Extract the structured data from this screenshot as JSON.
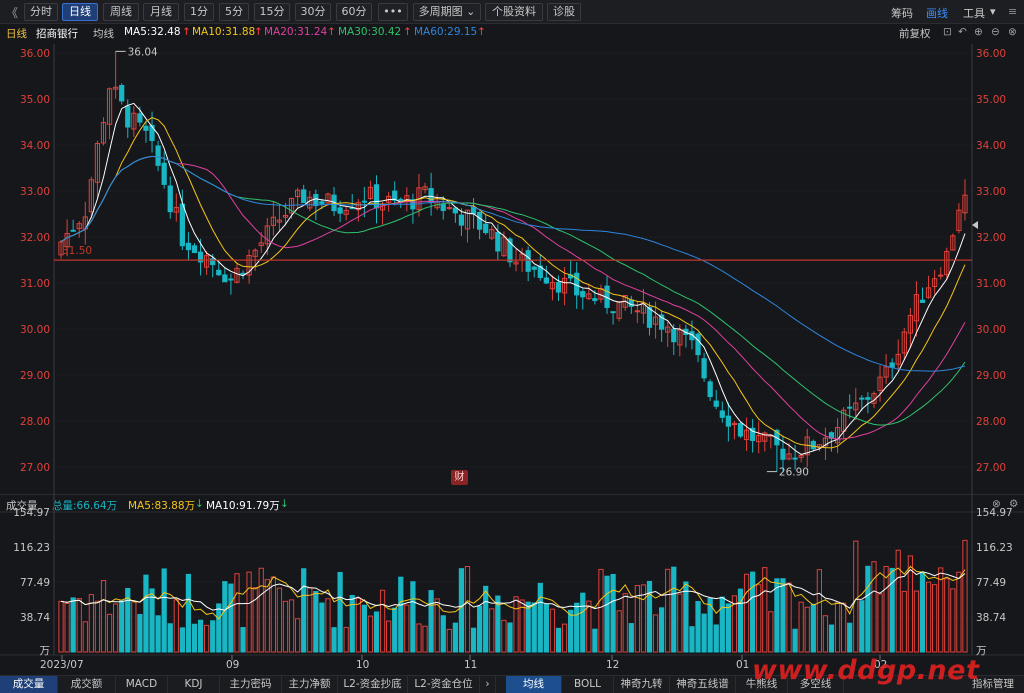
{
  "toolbar": {
    "back": "《",
    "periods": [
      "分时",
      "日线",
      "周线",
      "月线",
      "1分",
      "5分",
      "15分",
      "30分",
      "60分"
    ],
    "active_period": "日线",
    "more": "•••",
    "multi": "多周期图",
    "stock_info": "个股资料",
    "diagnose": "诊股",
    "right": [
      "筹码",
      "画线",
      "工具"
    ],
    "active_right": "画线"
  },
  "info": {
    "period_label": "日线",
    "stock_name": "招商银行",
    "ma_type": "均线",
    "ma5": "MA5:32.48",
    "ma10": "MA10:31.88",
    "ma20": "MA20:31.24",
    "ma30": "MA30:30.42",
    "ma60": "MA60:29.15",
    "adjust": "前复权"
  },
  "volume_info": {
    "title": "成交量",
    "total": "总量:66.64万",
    "ma5": "MA5:83.88万",
    "ma10": "MA10:91.79万"
  },
  "price_axis": [
    "36.00",
    "35.00",
    "34.00",
    "33.00",
    "32.00",
    "31.00",
    "30.00",
    "29.00",
    "28.00",
    "27.00"
  ],
  "volume_axis": [
    "154.97",
    "116.23",
    "77.49",
    "38.74",
    "万"
  ],
  "date_axis": [
    "2023/07",
    "09",
    "10",
    "11",
    "12",
    "01",
    "02"
  ],
  "annotations": {
    "high": "36.04",
    "low": "26.90",
    "line_level": "31.50",
    "badge": "财"
  },
  "bottom_tabs_left": [
    "成交量",
    "成交额",
    "MACD",
    "KDJ",
    "主力密码",
    "主力净额",
    "L2-资金抄底",
    "L2-资金仓位"
  ],
  "bottom_tabs_right": [
    "均线",
    "BOLL",
    "神奇九转",
    "神奇五线谱",
    "牛熊线",
    "多空线"
  ],
  "index_manage": "指标管理",
  "watermark": "www.ddgp.net",
  "colors": {
    "up": "#e0413a",
    "down": "#19b6c4",
    "ma5": "#ffffff",
    "ma10": "#f5c518",
    "ma20": "#e040a0",
    "ma30": "#2ec26b",
    "ma60": "#2e86de",
    "accent": "#3a8dff"
  },
  "chart_data": {
    "type": "candlestick",
    "ylim": [
      26.5,
      36.2
    ],
    "ma_final": {
      "MA5": 32.48,
      "MA10": 31.88,
      "MA20": 31.24,
      "MA30": 30.42,
      "MA60": 29.15
    },
    "high": 36.04,
    "low": 26.9,
    "volume_ylim": [
      0,
      154.97
    ],
    "volume_unit": "万",
    "volume_total": 66.64,
    "volume_ma5": 83.88,
    "volume_ma10": 91.79
  }
}
